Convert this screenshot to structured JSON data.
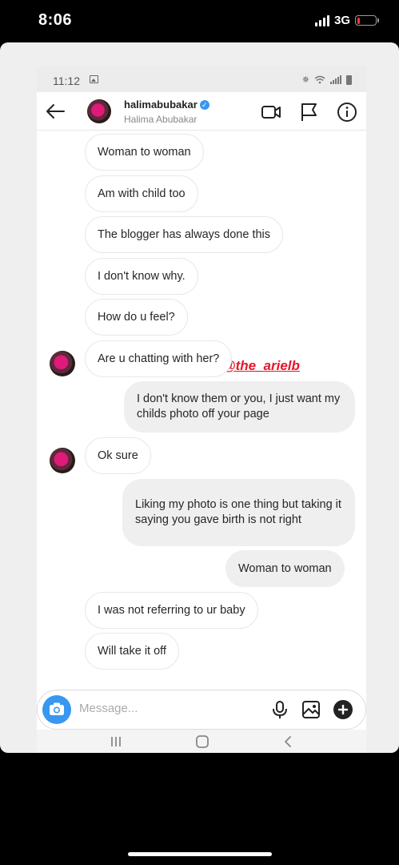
{
  "device": {
    "time": "8:06",
    "network": "3G",
    "signal_bars": 4,
    "battery_level": 0.12,
    "battery_color": "#ff3b30"
  },
  "android": {
    "time": "11:12"
  },
  "header": {
    "username": "halimabubakar",
    "full_name": "Halima Abubakar",
    "verified_color": "#3897f0"
  },
  "watermark": "@the_arielb",
  "messages": [
    {
      "side": "in",
      "text": "Woman to woman",
      "avatar": false
    },
    {
      "side": "in",
      "text": "Am with child too",
      "avatar": false
    },
    {
      "side": "in",
      "text": "The blogger has always done this",
      "avatar": false
    },
    {
      "side": "in",
      "text": "I don't know why.",
      "avatar": false
    },
    {
      "side": "in",
      "text": "How do u feel?",
      "avatar": false
    },
    {
      "side": "in",
      "text": "Are u chatting with her?",
      "avatar": true
    },
    {
      "side": "out",
      "text": "I don't know them or you, I just want my childs photo off your page"
    },
    {
      "side": "in",
      "text": "Ok sure",
      "avatar": true
    },
    {
      "side": "out",
      "text": "Liking my photo is one thing but taking it saying you gave birth is not right"
    },
    {
      "side": "out",
      "text": "Woman to woman"
    },
    {
      "side": "in",
      "text": "I was not referring to ur baby",
      "avatar": false
    },
    {
      "side": "in",
      "text": "Will take it off",
      "avatar": false
    }
  ],
  "composer": {
    "placeholder": "Message..."
  },
  "colors": {
    "accent": "#3897f0",
    "outgoing_bubble": "#efefef",
    "watermark": "#e4162b"
  }
}
